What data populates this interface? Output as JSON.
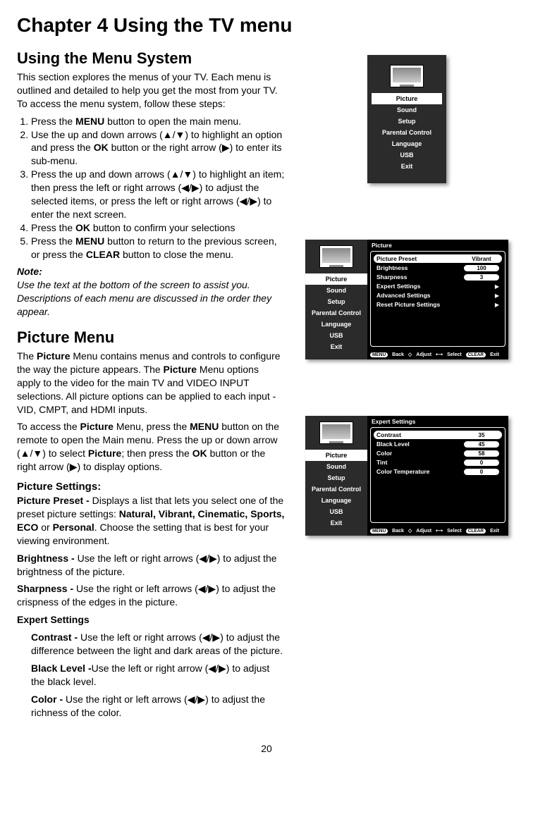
{
  "chapter_title": "Chapter 4 Using the TV menu",
  "section1": "Using the Menu System",
  "intro": "This section explores the menus of your TV. Each menu is outlined and detailed to help you get the most from your TV. To access the menu system, follow these steps:",
  "step1a": "Press the ",
  "step1b": "MENU",
  "step1c": " button to open the main menu.",
  "step2a": "Use the up and down arrows (",
  "step2b": "▲/▼",
  "step2c": ") to highlight an option and press the ",
  "step2d": "OK",
  "step2e": " button or the right arrow (",
  "step2f": "▶",
  "step2g": ") to enter its sub-menu.",
  "step3a": "Press the up and down arrows (",
  "step3b": "▲/▼",
  "step3c": ") to highlight an item; then press the left or right arrows (",
  "step3d": "◀/▶",
  "step3e": ") to adjust the selected items, or press the left or right arrows (",
  "step3f": "◀/▶",
  "step3g": ") to enter the next screen.",
  "step4a": "Press the ",
  "step4b": "OK",
  "step4c": " button to confirm your selections",
  "step5a": "Press the ",
  "step5b": "MENU",
  "step5c": " button to return to the previous screen, or press the ",
  "step5d": "CLEAR",
  "step5e": " button to close the menu.",
  "note_title": "Note:",
  "note_body": "Use the text at the bottom of the screen to assist you. Descriptions of each menu are discussed in the order they appear.",
  "section2": "Picture Menu",
  "pm1a": "The ",
  "pm1b": "Picture",
  "pm1c": " Menu contains menus and controls to configure the way the picture appears. The ",
  "pm1d": "Picture",
  "pm1e": " Menu options apply to the video for the main TV and VIDEO INPUT selections. All picture options can be applied to each input - VID, CMPT, and HDMI inputs.",
  "pm2a": "To access the ",
  "pm2b": "Picture",
  "pm2c": " Menu, press the ",
  "pm2d": "MENU",
  "pm2e": " button on the remote to open the Main menu. Press the up or down arrow (",
  "pm2f": "▲/▼",
  "pm2g": ") to select ",
  "pm2h": "Picture",
  "pm2i": "; then press the ",
  "pm2j": "OK",
  "pm2k": " button or the right arrow (",
  "pm2l": "▶",
  "pm2m": ") to display options.",
  "ps_title": "Picture Settings:",
  "pp1a": "Picture Preset - ",
  "pp1b": " Displays a list that lets you select one of the preset picture settings: ",
  "pp1c": "Natural, Vibrant, Cinematic, Sports, ECO",
  "pp1d": " or ",
  "pp1e": "Personal",
  "pp1f": ". Choose the setting that is best for your viewing environment.",
  "br1a": "Brightness - ",
  "br1b": " Use the left or right arrows (",
  "br1c": "◀/▶",
  "br1d": ") to adjust the brightness of the picture.",
  "sh1a": "Sharpness -",
  "sh1b": " Use the right or left arrows (",
  "sh1c": "◀/▶",
  "sh1d": ") to adjust the crispness of the edges in the picture.",
  "ex_title": "Expert Settings",
  "co1a": "Contrast -",
  "co1b": " Use the left or right arrows (",
  "co1c": "◀/▶",
  "co1d": ") to adjust the difference between the light and dark areas of the picture.",
  "bl1a": "Black Level -",
  "bl1b": "Use the left or right arrow (",
  "bl1c": "◀/▶",
  "bl1d": ") to adjust the black level.",
  "cr1a": "Color -",
  "cr1b": " Use the right or left arrows (",
  "cr1c": "◀/▶",
  "cr1d": ") to adjust the richness of the color.",
  "page": "20",
  "sidebar": {
    "items": [
      "Picture",
      "Sound",
      "Setup",
      "Parental Control",
      "Language",
      "USB",
      "Exit"
    ]
  },
  "panel_picture": {
    "title": "Picture",
    "rows": [
      {
        "label": "Picture Preset",
        "value": "Vibrant",
        "sel": true
      },
      {
        "label": "Brightness",
        "value": "100"
      },
      {
        "label": "Sharpness",
        "value": "3"
      },
      {
        "label": "Expert Settings",
        "chev": true
      },
      {
        "label": "Advanced Settings",
        "chev": true
      },
      {
        "label": "Reset Picture Settings",
        "chev": true
      }
    ]
  },
  "panel_expert": {
    "title": "Expert Settings",
    "rows": [
      {
        "label": "Contrast",
        "value": "35",
        "sel": true
      },
      {
        "label": "Black Level",
        "value": "45"
      },
      {
        "label": "Color",
        "value": "58"
      },
      {
        "label": "Tint",
        "value": "0"
      },
      {
        "label": "Color Temperature",
        "value": "0"
      }
    ]
  },
  "footer": {
    "menu": "MENU",
    "back": "Back",
    "adjust": "Adjust",
    "select": "Select",
    "clear": "CLEAR",
    "exit": "Exit"
  }
}
